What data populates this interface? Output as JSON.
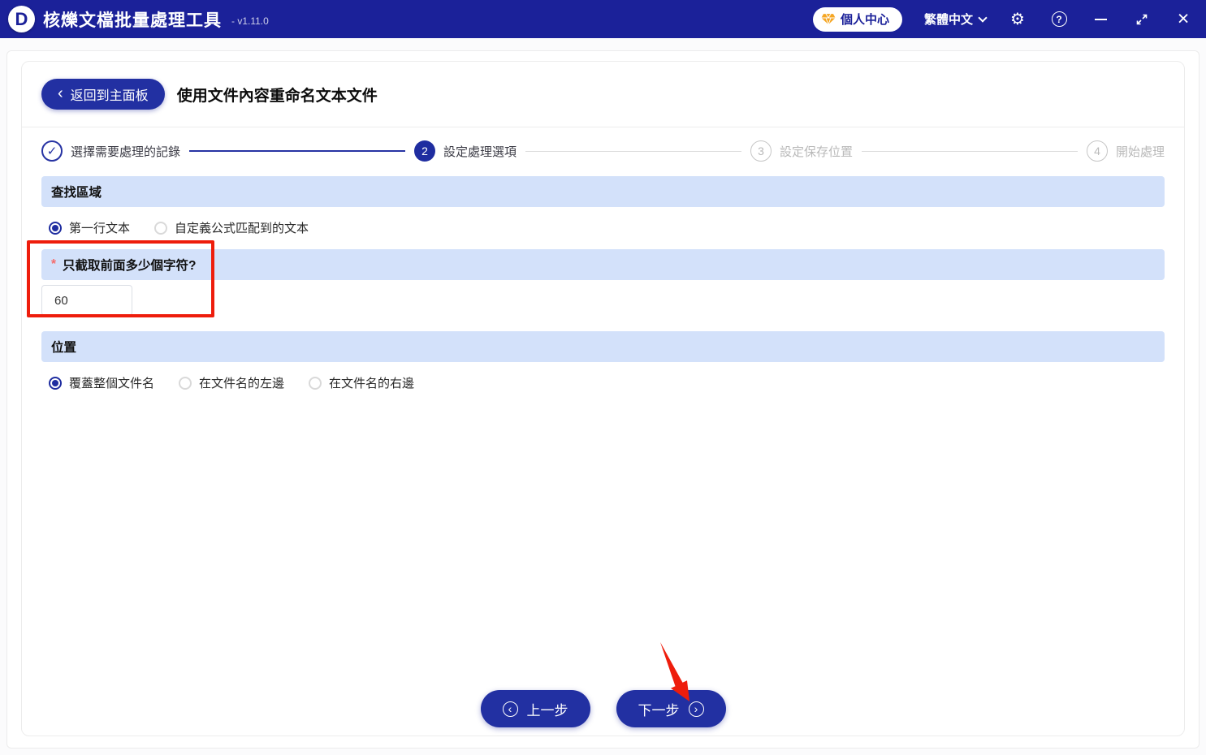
{
  "titlebar": {
    "logo_letter": "D",
    "app_title": "核爍文檔批量處理工具",
    "version": "- v1.11.0",
    "user_center_label": "個人中心",
    "language_label": "繁體中文"
  },
  "header": {
    "back_label": "返回到主面板",
    "page_title": "使用文件內容重命名文本文件"
  },
  "steps": [
    {
      "num": "1",
      "label": "選擇需要處理的記錄",
      "state": "done"
    },
    {
      "num": "2",
      "label": "設定處理選項",
      "state": "active"
    },
    {
      "num": "3",
      "label": "設定保存位置",
      "state": "pending"
    },
    {
      "num": "4",
      "label": "開始處理",
      "state": "pending"
    }
  ],
  "sections": {
    "search_area": {
      "title": "查找區域",
      "options": [
        {
          "label": "第一行文本",
          "selected": true
        },
        {
          "label": "自定義公式匹配到的文本",
          "selected": false
        }
      ]
    },
    "char_count": {
      "required_mark": "*",
      "title": "只截取前面多少個字符?",
      "value": "60"
    },
    "position": {
      "title": "位置",
      "options": [
        {
          "label": "覆蓋整個文件名",
          "selected": true
        },
        {
          "label": "在文件名的左邊",
          "selected": false
        },
        {
          "label": "在文件名的右邊",
          "selected": false
        }
      ]
    }
  },
  "footer": {
    "prev_label": "上一步",
    "next_label": "下一步"
  },
  "icons": {
    "check": "✓",
    "gear": "⚙",
    "question": "?",
    "close": "×",
    "back_chevron": "‹",
    "chevron_left": "‹",
    "chevron_right": "›"
  },
  "colors": {
    "titlebar_bg": "#1b2199",
    "primary_button": "#2230a2",
    "section_header_bg": "#d3e1fa",
    "annotation_red": "#ee1d0c",
    "gem_yellow": "#f5a623",
    "required_red": "#f56c6c"
  }
}
